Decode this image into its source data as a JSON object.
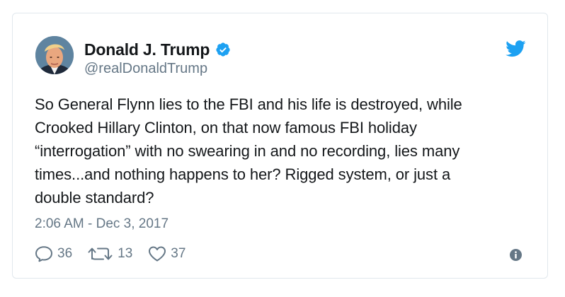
{
  "tweet": {
    "author_name": "Donald J. Trump",
    "author_handle": "@realDonaldTrump",
    "text": "So General Flynn lies to the FBI and his life is destroyed, while\nCrooked Hillary Clinton, on that now famous FBI holiday\n“interrogation” with no swearing in and no recording, lies many\ntimes...and nothing happens to her? Rigged system, or just a\ndouble standard?",
    "timestamp": "2:06 AM - Dec 3, 2017",
    "replies": "36",
    "retweets": "13",
    "likes": "37"
  },
  "icons": {
    "avatar": "avatar-photo",
    "verified": "verified-badge-icon",
    "brand": "twitter-bird-icon",
    "reply": "reply-icon",
    "retweet": "retweet-icon",
    "like": "heart-icon",
    "info": "info-icon"
  },
  "colors": {
    "brand_blue": "#1da1f2",
    "text": "#14171a",
    "secondary": "#657786",
    "border": "#e1e8ed"
  }
}
